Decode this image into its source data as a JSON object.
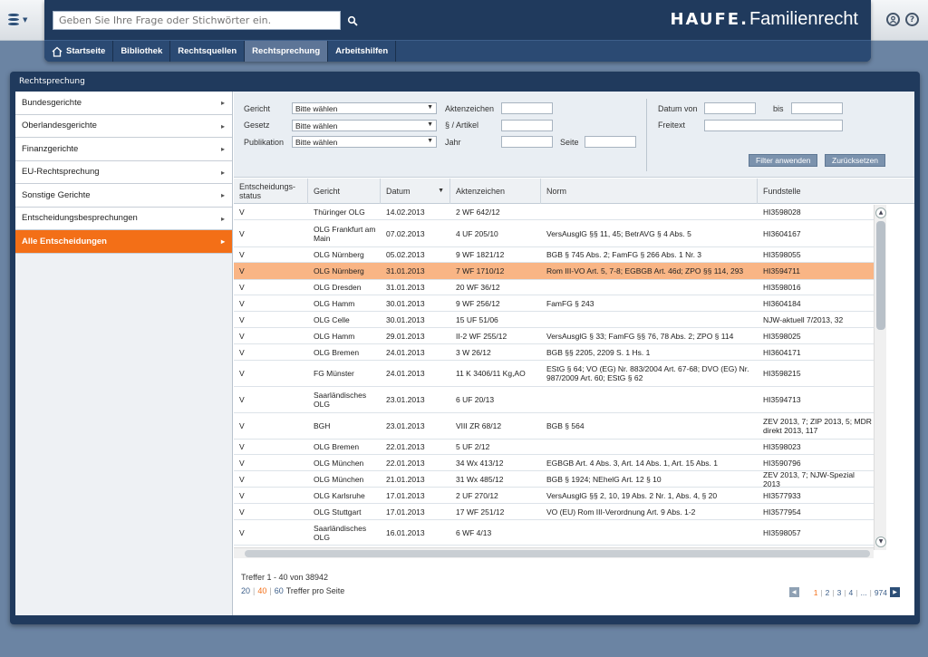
{
  "search": {
    "placeholder": "Geben Sie Ihre Frage oder Stichwörter ein."
  },
  "brand": {
    "part1": "HAUFE.",
    "part2": "Familienrecht"
  },
  "nav": {
    "tabs": [
      {
        "label": "Startseite"
      },
      {
        "label": "Bibliothek"
      },
      {
        "label": "Rechtsquellen"
      },
      {
        "label": "Rechtsprechung",
        "active": true
      },
      {
        "label": "Arbeitshilfen"
      }
    ]
  },
  "main": {
    "title": "Rechtsprechung"
  },
  "sidebar": {
    "items": [
      {
        "label": "Bundesgerichte"
      },
      {
        "label": "Oberlandesgerichte"
      },
      {
        "label": "Finanzgerichte"
      },
      {
        "label": "EU-Rechtsprechung"
      },
      {
        "label": "Sonstige Gerichte"
      },
      {
        "label": "Entscheidungsbesprechungen"
      },
      {
        "label": "Alle Entscheidungen",
        "active": true
      }
    ]
  },
  "filter": {
    "gericht_label": "Gericht",
    "gericht_value": "Bitte wählen",
    "gesetz_label": "Gesetz",
    "gesetz_value": "Bitte wählen",
    "publikation_label": "Publikation",
    "publikation_value": "Bitte wählen",
    "aktenzeichen_label": "Aktenzeichen",
    "artikel_label": "§ / Artikel",
    "jahr_label": "Jahr",
    "seite_label": "Seite",
    "datum_von_label": "Datum von",
    "bis_label": "bis",
    "freitext_label": "Freitext",
    "apply_label": "Filter anwenden",
    "reset_label": "Zurücksetzen"
  },
  "table": {
    "headers": {
      "status": "Entscheidungs-status",
      "gericht": "Gericht",
      "datum": "Datum",
      "aktenzeichen": "Aktenzeichen",
      "norm": "Norm",
      "fundstelle": "Fundstelle"
    },
    "rows": [
      {
        "status": "V",
        "gericht": "Thüringer OLG",
        "datum": "14.02.2013",
        "az": "2 WF 642/12",
        "norm": "",
        "fund": "HI3598028"
      },
      {
        "status": "V",
        "gericht": "OLG Frankfurt am Main",
        "datum": "07.02.2013",
        "az": "4 UF 205/10",
        "norm": "VersAusglG §§ 11, 45; BetrAVG § 4 Abs. 5",
        "fund": "HI3604167"
      },
      {
        "status": "V",
        "gericht": "OLG Nürnberg",
        "datum": "05.02.2013",
        "az": "9 WF 1821/12",
        "norm": "BGB § 745 Abs. 2; FamFG § 266 Abs. 1 Nr. 3",
        "fund": "HI3598055"
      },
      {
        "status": "V",
        "gericht": "OLG Nürnberg",
        "datum": "31.01.2013",
        "az": "7 WF 1710/12",
        "norm": "Rom III-VO Art. 5, 7-8; EGBGB Art. 46d; ZPO §§ 114, 293",
        "fund": "HI3594711",
        "selected": true
      },
      {
        "status": "V",
        "gericht": "OLG Dresden",
        "datum": "31.01.2013",
        "az": "20 WF 36/12",
        "norm": "",
        "fund": "HI3598016"
      },
      {
        "status": "V",
        "gericht": "OLG Hamm",
        "datum": "30.01.2013",
        "az": "9 WF 256/12",
        "norm": "FamFG § 243",
        "fund": "HI3604184"
      },
      {
        "status": "V",
        "gericht": "OLG Celle",
        "datum": "30.01.2013",
        "az": "15 UF 51/06",
        "norm": "",
        "fund": "NJW-aktuell 7/2013, 32"
      },
      {
        "status": "V",
        "gericht": "OLG Hamm",
        "datum": "29.01.2013",
        "az": "II-2 WF 255/12",
        "norm": "VersAusglG § 33; FamFG §§ 76, 78 Abs. 2; ZPO § 114",
        "fund": "HI3598025"
      },
      {
        "status": "V",
        "gericht": "OLG Bremen",
        "datum": "24.01.2013",
        "az": "3 W 26/12",
        "norm": "BGB §§ 2205, 2209 S. 1 Hs. 1",
        "fund": "HI3604171"
      },
      {
        "status": "V",
        "gericht": "FG Münster",
        "datum": "24.01.2013",
        "az": "11 K 3406/11 Kg,AO",
        "norm": "EStG § 64; VO (EG) Nr. 883/2004 Art. 67-68; DVO (EG) Nr. 987/2009 Art. 60; EStG § 62",
        "fund": "HI3598215"
      },
      {
        "status": "V",
        "gericht": "Saarländisches OLG",
        "datum": "23.01.2013",
        "az": "6 UF 20/13",
        "norm": "",
        "fund": "HI3594713"
      },
      {
        "status": "V",
        "gericht": "BGH",
        "datum": "23.01.2013",
        "az": "VIII ZR 68/12",
        "norm": "BGB § 564",
        "fund": "ZEV 2013, 7; ZIP 2013, 5; MDR direkt 2013, 117"
      },
      {
        "status": "V",
        "gericht": "OLG Bremen",
        "datum": "22.01.2013",
        "az": "5 UF 2/12",
        "norm": "",
        "fund": "HI3598023"
      },
      {
        "status": "V",
        "gericht": "OLG München",
        "datum": "22.01.2013",
        "az": "34 Wx 413/12",
        "norm": "EGBGB Art. 4 Abs. 3, Art. 14 Abs. 1, Art. 15 Abs. 1",
        "fund": "HI3590796"
      },
      {
        "status": "V",
        "gericht": "OLG München",
        "datum": "21.01.2013",
        "az": "31 Wx 485/12",
        "norm": "BGB § 1924; NEhelG Art. 12 § 10",
        "fund": "ZEV 2013, 7; NJW-Spezial 2013"
      },
      {
        "status": "V",
        "gericht": "OLG Karlsruhe",
        "datum": "17.01.2013",
        "az": "2 UF 270/12",
        "norm": "VersAusglG §§ 2, 10, 19 Abs. 2 Nr. 1, Abs. 4, § 20",
        "fund": "HI3577933"
      },
      {
        "status": "V",
        "gericht": "OLG Stuttgart",
        "datum": "17.01.2013",
        "az": "17 WF 251/12",
        "norm": "VO (EU) Rom III-Verordnung Art. 9 Abs. 1-2",
        "fund": "HI3577954"
      },
      {
        "status": "V",
        "gericht": "Saarländisches OLG",
        "datum": "16.01.2013",
        "az": "6 WF 4/13",
        "norm": "",
        "fund": "HI3598057"
      }
    ]
  },
  "results": {
    "summary": "Treffer 1 - 40 von 38942",
    "page_sizes": [
      "20",
      "40",
      "60"
    ],
    "page_size_label": "Treffer pro Seite",
    "pages": [
      "1",
      "2",
      "3",
      "4",
      "...",
      "974"
    ]
  }
}
